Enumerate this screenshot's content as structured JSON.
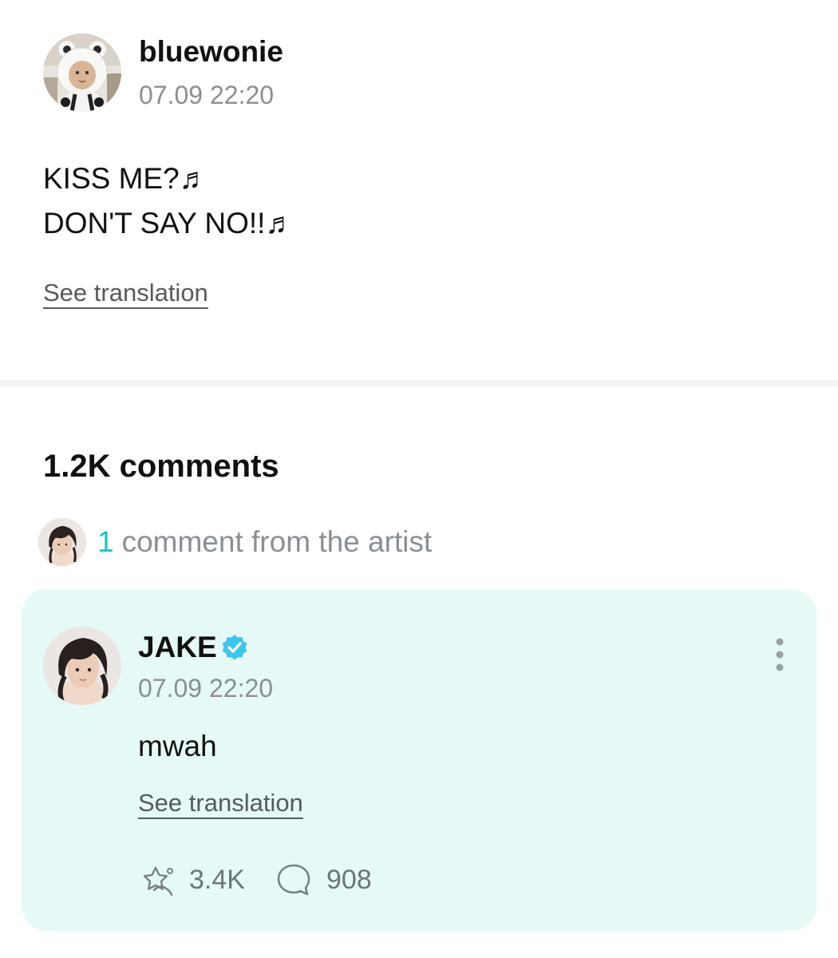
{
  "post": {
    "author": "bluewonie",
    "timestamp": "07.09 22:20",
    "body_lines": [
      "KISS ME?♬",
      "DON'T SAY NO!!♬"
    ],
    "see_translation": "See translation",
    "avatar_icon": "user-avatar-polar-bear-hood"
  },
  "comments": {
    "count_label": "1.2K comments",
    "artist_summary": {
      "count": "1",
      "label": "comment from the artist"
    },
    "artist_comment": {
      "author": "JAKE",
      "verified_icon": "verified-badge-icon",
      "timestamp": "07.09 22:20",
      "text": "mwah",
      "see_translation": "See translation",
      "likes": "3.4K",
      "replies": "908",
      "card_color": "#e5f9f6"
    }
  },
  "colors": {
    "accent": "#1cc3c0",
    "verified": "#39c6f0",
    "muted_text": "#8a8f94"
  }
}
